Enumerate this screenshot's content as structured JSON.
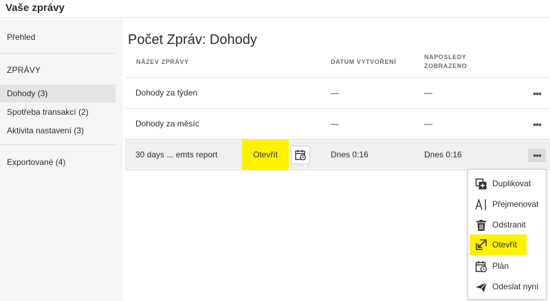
{
  "app": {
    "title": "Vaše zprávy"
  },
  "sidebar": {
    "overview": "Přehled",
    "section_heading": "ZPRÁVY",
    "items": [
      {
        "label": "Dohody (3)",
        "selected": true
      },
      {
        "label": "Spotřeba transakcí (2)",
        "selected": false
      },
      {
        "label": "Aktivita nastavení (3)",
        "selected": false
      }
    ],
    "exported": "Exportované (4)"
  },
  "main": {
    "title": "Počet Zpráv: Dohody",
    "columns": {
      "name": "NÁZEV ZPRÁVY",
      "created": "DATUM VYTVOŘENÍ",
      "viewed_line1": "NAPOSLEDY",
      "viewed_line2": "ZOBRAZENO"
    },
    "rows": [
      {
        "name": "Dohody za týden",
        "created": "—",
        "viewed": "—"
      },
      {
        "name": "Dohody za měsíc",
        "created": "—",
        "viewed": "—"
      },
      {
        "name": "30 days ... emts report",
        "created": "Dnes 0:16",
        "viewed": "Dnes 0:16"
      }
    ],
    "open_button": "Otevřít",
    "more_label": "•••"
  },
  "context_menu": {
    "items": [
      {
        "label": "Duplikovat",
        "icon": "duplicate-icon"
      },
      {
        "label": "Přejmenovat",
        "icon": "rename-icon"
      },
      {
        "label": "Odstranit",
        "icon": "trash-icon"
      },
      {
        "label": "Otevřít",
        "icon": "open-icon"
      },
      {
        "label": "Plán",
        "icon": "schedule-icon"
      },
      {
        "label": "Odeslat nyní",
        "icon": "send-icon"
      }
    ]
  },
  "colors": {
    "highlight": "#fff200",
    "sidebar_bg": "#f5f5f5",
    "selected_bg": "#e4e4e4"
  }
}
